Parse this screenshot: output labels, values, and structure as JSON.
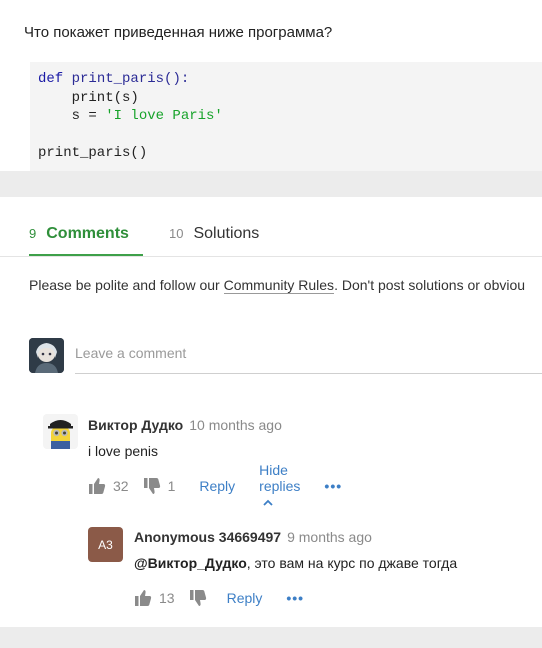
{
  "question": "Что покажет приведенная ниже программа?",
  "code": {
    "line1_kw": "def",
    "line1_fn": "print_paris():",
    "line2": "    print(s)",
    "line3_pre": "    s = ",
    "line3_str": "'I love Paris'",
    "line5": "print_paris()"
  },
  "tabs": [
    {
      "count": "9",
      "label": "Comments"
    },
    {
      "count": "10",
      "label": "Solutions"
    }
  ],
  "rules": {
    "before": "Please be polite and follow our ",
    "link": "Community Rules",
    "after": ". Don't post solutions or obviou"
  },
  "leave_comment": {
    "placeholder": "Leave a comment"
  },
  "comments": [
    {
      "author": "Виктор Дудко",
      "time": "10 months ago",
      "text": "i love penis",
      "likes": "32",
      "dislikes": "1",
      "reply": "Reply",
      "hide_replies": "Hide replies",
      "more": "•••"
    }
  ],
  "reply": {
    "initials": "A3",
    "author": "Anonymous 34669497",
    "time": "9 months ago",
    "mention": "@Виктор_Дудко",
    "text": ", это вам на курс по джаве тогда",
    "likes": "13",
    "reply": "Reply",
    "more": "•••"
  },
  "colors": {
    "accent_green": "#3ea049",
    "link_blue": "#3d7fc6",
    "avatar_brown": "#8b5a48"
  }
}
